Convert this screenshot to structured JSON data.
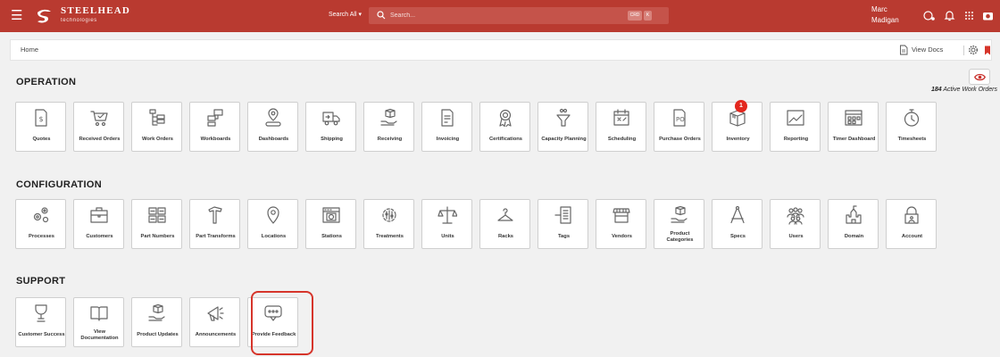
{
  "header": {
    "brand": "STEELHEAD",
    "brand_sub": "technologies",
    "search_scope": "Search All",
    "search_placeholder": "Search...",
    "kbd_ctrl": "CRD",
    "kbd_k": "K",
    "user_first": "Marc",
    "user_last": "Madigan",
    "accent": "#b93a30"
  },
  "subbar": {
    "breadcrumb": "Home",
    "view_docs": "View Docs"
  },
  "stats": {
    "active_count": "184",
    "active_label": "Active Work Orders"
  },
  "sections": {
    "operation": {
      "title": "OPERATION",
      "tiles": [
        {
          "label": "Quotes",
          "icon": "quote-icon"
        },
        {
          "label": "Received Orders",
          "icon": "cart-icon"
        },
        {
          "label": "Work Orders",
          "icon": "work-orders-icon"
        },
        {
          "label": "Workboards",
          "icon": "workboard-icon"
        },
        {
          "label": "Dashboards",
          "icon": "dashboard-icon"
        },
        {
          "label": "Shipping",
          "icon": "truck-icon"
        },
        {
          "label": "Receiving",
          "icon": "receiving-icon"
        },
        {
          "label": "Invoicing",
          "icon": "invoice-icon"
        },
        {
          "label": "Certifications",
          "icon": "certificate-icon"
        },
        {
          "label": "Capacity Planning",
          "icon": "capacity-icon"
        },
        {
          "label": "Scheduling",
          "icon": "calendar-icon"
        },
        {
          "label": "Purchase Orders",
          "icon": "purchase-order-icon"
        },
        {
          "label": "Inventory",
          "icon": "inventory-icon"
        },
        {
          "label": "Reporting",
          "icon": "chart-icon"
        },
        {
          "label": "Timer Dashboard",
          "icon": "timer-dashboard-icon"
        },
        {
          "label": "Timesheets",
          "icon": "stopwatch-icon"
        }
      ],
      "badge": "1"
    },
    "configuration": {
      "title": "CONFIGURATION",
      "tiles": [
        {
          "label": "Processes",
          "icon": "gears-icon"
        },
        {
          "label": "Customers",
          "icon": "briefcase-icon"
        },
        {
          "label": "Part Numbers",
          "icon": "part-numbers-icon"
        },
        {
          "label": "Part Transforms",
          "icon": "hammer-icon"
        },
        {
          "label": "Locations",
          "icon": "location-pin-icon"
        },
        {
          "label": "Stations",
          "icon": "station-icon"
        },
        {
          "label": "Treatments",
          "icon": "treatment-icon"
        },
        {
          "label": "Units",
          "icon": "scale-icon"
        },
        {
          "label": "Racks",
          "icon": "hanger-icon"
        },
        {
          "label": "Tags",
          "icon": "tag-icon"
        },
        {
          "label": "Vendors",
          "icon": "store-icon"
        },
        {
          "label": "Product Categories",
          "icon": "product-categories-icon"
        },
        {
          "label": "Specs",
          "icon": "compass-icon"
        },
        {
          "label": "Users",
          "icon": "users-icon"
        },
        {
          "label": "Domain",
          "icon": "castle-icon"
        },
        {
          "label": "Account",
          "icon": "account-lock-icon"
        }
      ]
    },
    "support": {
      "title": "SUPPORT",
      "tiles": [
        {
          "label": "Customer Success",
          "icon": "trophy-icon"
        },
        {
          "label": "View Documentation",
          "icon": "book-icon"
        },
        {
          "label": "Product Updates",
          "icon": "product-updates-icon"
        },
        {
          "label": "Announcements",
          "icon": "megaphone-icon"
        },
        {
          "label": "Provide Feedback",
          "icon": "feedback-icon"
        }
      ]
    }
  }
}
